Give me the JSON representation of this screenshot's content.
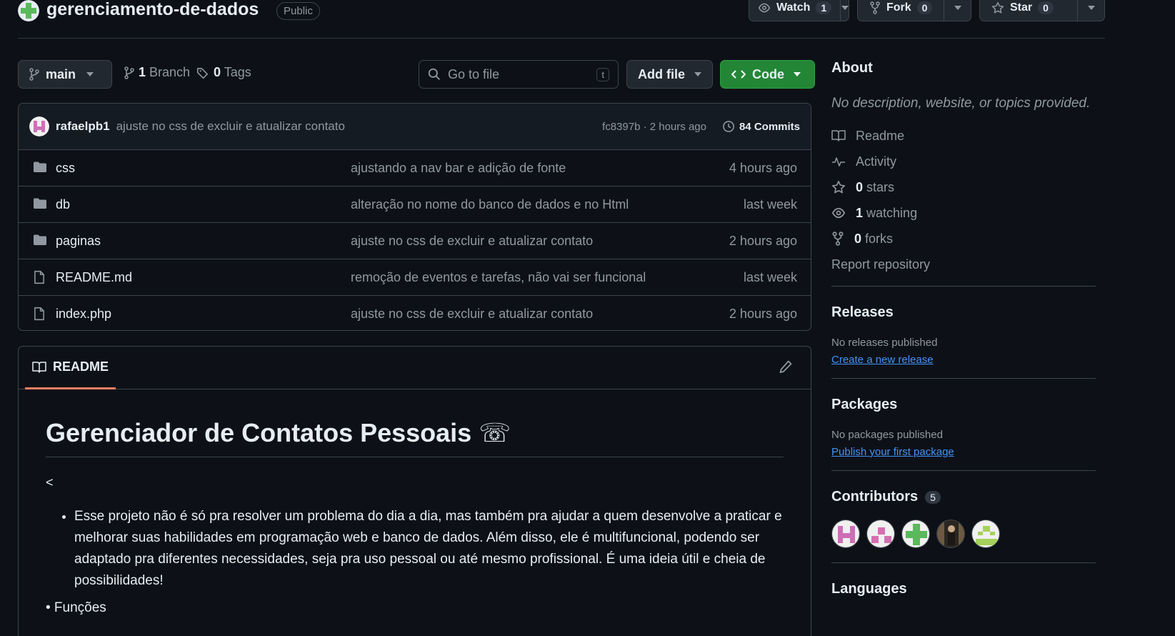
{
  "repo": {
    "name": "gerenciamento-de-dados",
    "visibility": "Public",
    "watch_label": "Watch",
    "watch_count": "1",
    "fork_label": "Fork",
    "fork_count": "0",
    "star_label": "Star",
    "star_count": "0"
  },
  "nav": {
    "branch": "main",
    "branch_count": "1",
    "branch_label": "Branch",
    "tag_count": "0",
    "tag_label": "Tags",
    "search_placeholder": "Go to file",
    "search_kbd": "t",
    "add_file_label": "Add file",
    "code_label": "Code"
  },
  "commit": {
    "author": "rafaelpb1",
    "message": "ajuste no css de excluir e atualizar contato",
    "hash_time": "fc8397b · 2 hours ago",
    "count_label": "84 Commits"
  },
  "files": [
    {
      "name": "css",
      "type": "folder",
      "message": "ajustando a nav bar e adição de fonte",
      "time": "4 hours ago"
    },
    {
      "name": "db",
      "type": "folder",
      "message": "alteração no nome do banco de dados e no Html",
      "time": "last week"
    },
    {
      "name": "paginas",
      "type": "folder",
      "message": "ajuste no css de excluir e atualizar contato",
      "time": "2 hours ago"
    },
    {
      "name": "README.md",
      "type": "file",
      "message": "remoção de eventos e tarefas, não vai ser funcional",
      "time": "last week"
    },
    {
      "name": "index.php",
      "type": "file",
      "message": "ajuste no css de excluir e atualizar contato",
      "time": "2 hours ago"
    }
  ],
  "readme": {
    "tab_label": "README",
    "title": "Gerenciador de Contatos Pessoais ☏",
    "lt_line": "<",
    "paragraph": "Esse projeto não é só pra resolver um problema do dia a dia, mas também pra ajudar a quem desenvolve a praticar e melhorar suas habilidades em programação web e banco de dados. Além disso, ele é multifuncional, podendo ser adaptado pra diferentes necessidades, seja pra uso pessoal ou até mesmo profissional. É uma ideia útil e cheia de possibilidades!",
    "functions_line": "• Funções"
  },
  "about": {
    "title": "About",
    "description": "No description, website, or topics provided.",
    "readme_link": "Readme",
    "activity_link": "Activity",
    "stars_count": "0",
    "stars_label": "stars",
    "watching_count": "1",
    "watching_label": "watching",
    "forks_count": "0",
    "forks_label": "forks",
    "report_link": "Report repository"
  },
  "releases": {
    "title": "Releases",
    "none_text": "No releases published",
    "create_link": "Create a new release"
  },
  "packages": {
    "title": "Packages",
    "none_text": "No packages published",
    "publish_link": "Publish your first package"
  },
  "contributors": {
    "title": "Contributors",
    "count": "5"
  },
  "languages": {
    "title": "Languages"
  },
  "colors": {
    "background": "#0d1117",
    "border": "#3d444d",
    "code_button": "#238636",
    "link": "#4493f8",
    "tab_underline": "#f78166"
  }
}
